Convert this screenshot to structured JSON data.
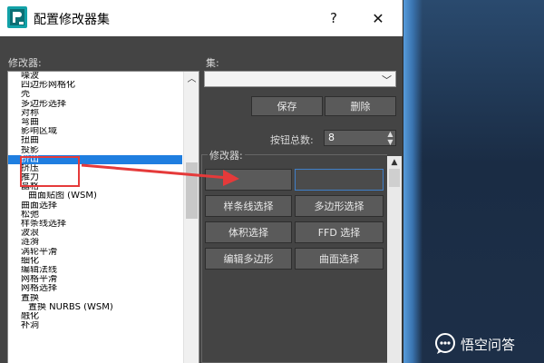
{
  "window": {
    "title": "配置修改器集",
    "help_label": "?",
    "close_label": "✕"
  },
  "left_panel": {
    "label": "修改器:",
    "items": [
      {
        "label": "噪波",
        "sub": false
      },
      {
        "label": "四边形网格化",
        "sub": false
      },
      {
        "label": "壳",
        "sub": false
      },
      {
        "label": "多边形选择",
        "sub": false
      },
      {
        "label": "对称",
        "sub": false
      },
      {
        "label": "弯曲",
        "sub": false
      },
      {
        "label": "影响区域",
        "sub": false
      },
      {
        "label": "扭曲",
        "sub": false
      },
      {
        "label": "投影",
        "sub": false
      },
      {
        "label": "挤出",
        "sub": false,
        "selected": true
      },
      {
        "label": "挤压",
        "sub": false
      },
      {
        "label": "推力",
        "sub": false
      },
      {
        "label": "晶格",
        "sub": false
      },
      {
        "label": "曲面贴图 (WSM)",
        "sub": true
      },
      {
        "label": "曲面选择",
        "sub": false
      },
      {
        "label": "松弛",
        "sub": false
      },
      {
        "label": "样条线选择",
        "sub": false
      },
      {
        "label": "波浪",
        "sub": false
      },
      {
        "label": "涟漪",
        "sub": false
      },
      {
        "label": "涡轮平滑",
        "sub": false
      },
      {
        "label": "细化",
        "sub": false
      },
      {
        "label": "编辑法线",
        "sub": false
      },
      {
        "label": "网格平滑",
        "sub": false
      },
      {
        "label": "网格选择",
        "sub": false
      },
      {
        "label": "置换",
        "sub": false
      },
      {
        "label": "置换 NURBS (WSM)",
        "sub": true
      },
      {
        "label": "融化",
        "sub": false
      },
      {
        "label": "补洞",
        "sub": false
      }
    ]
  },
  "right_panel": {
    "set_label": "集:",
    "set_value": "",
    "save_label": "保存",
    "delete_label": "删除",
    "count_label": "按钮总数:",
    "count_value": "8",
    "group_label": "修改器:",
    "buttons": [
      "样条线选择",
      "多边形选择",
      "体积选择",
      "FFD 选择",
      "编辑多边形",
      "曲面选择"
    ]
  },
  "watermark": {
    "text": "悟空问答"
  },
  "colors": {
    "dialog_bg": "#444444",
    "selection": "#1f7ee0",
    "annotation_red": "#e53a3a",
    "active_slot_border": "#3f7fc8"
  }
}
